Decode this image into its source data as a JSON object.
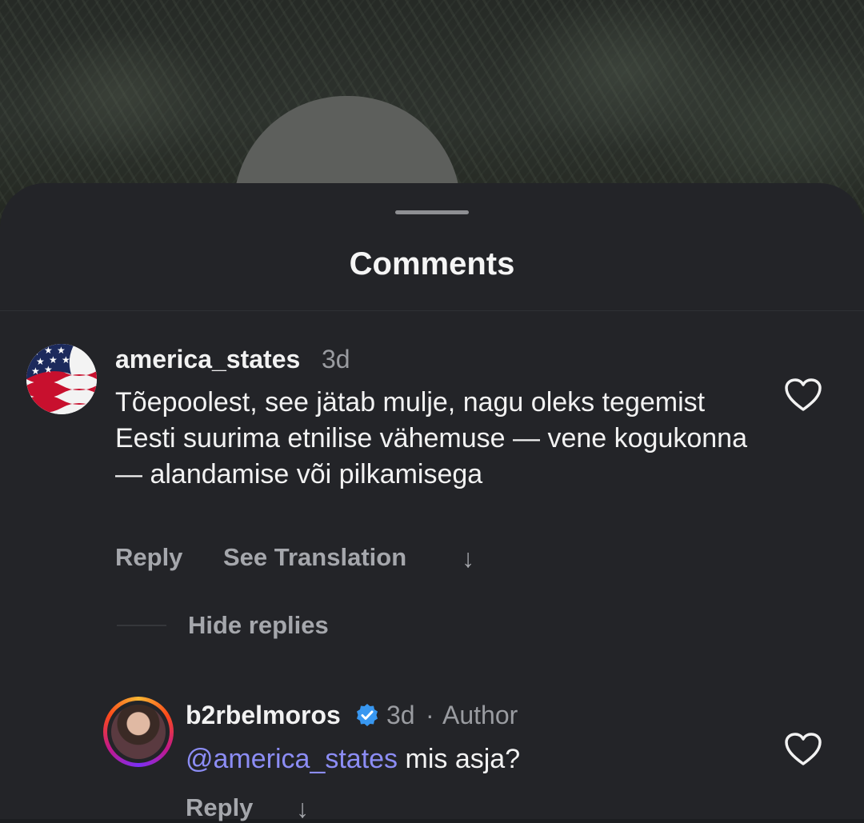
{
  "sheet": {
    "title": "Comments"
  },
  "comment": {
    "username": "america_states",
    "time": "3d",
    "text": "Tõepoolest, see jätab mulje, nagu oleks tegemist Eesti suurima etnilise vähemuse — vene kogukonna — alandamise või pilkamisega",
    "reply_label": "Reply",
    "translate_label": "See Translation",
    "avatar_icon": "us-flag-icon",
    "like_icon": "heart-outline-icon"
  },
  "replies_toggle": {
    "label": "Hide replies"
  },
  "reply": {
    "username": "b2rbelmoros",
    "verified_icon": "verified-badge-icon",
    "time": "3d",
    "separator": "·",
    "badge": "Author",
    "mention": "@america_states",
    "text": " mis asja?",
    "reply_label": "Reply",
    "like_icon": "heart-outline-icon"
  },
  "colors": {
    "mention": "#8c8df5",
    "verified": "#3897f0",
    "sheet_bg": "#232428"
  }
}
